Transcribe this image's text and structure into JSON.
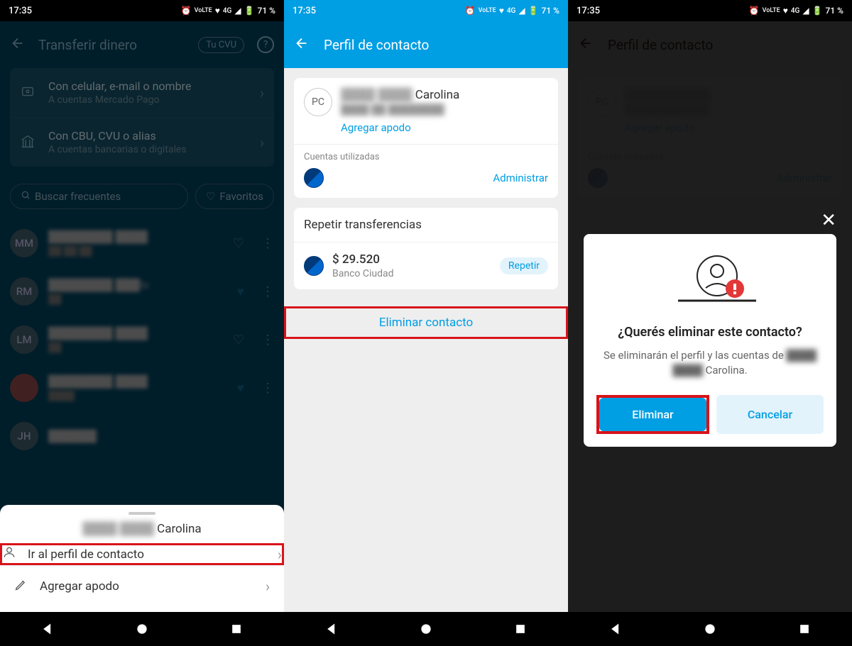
{
  "status": {
    "time": "17:35",
    "battery": "71 %",
    "network": "4G",
    "lte": "VoLTE"
  },
  "screen1": {
    "header": {
      "title": "Transferir dinero",
      "cvu": "Tu CVU"
    },
    "options": [
      {
        "title": "Con celular, e-mail o nombre",
        "subtitle": "A cuentas Mercado Pago"
      },
      {
        "title": "Con CBU, CVU o alias",
        "subtitle": "A cuentas bancarias o digitales"
      }
    ],
    "search": "Buscar frecuentes",
    "favorites": "Favoritos",
    "contacts": [
      {
        "initials": "MM",
        "fav": false
      },
      {
        "initials": "RM",
        "name_suffix": "lo",
        "fav": true
      },
      {
        "initials": "LM",
        "fav": false
      },
      {
        "initials": "",
        "avatar": true,
        "fav": true
      },
      {
        "initials": "JH",
        "fav": false
      }
    ],
    "sheet": {
      "name_visible": "Carolina",
      "go_profile": "Ir al perfil de contacto",
      "add_nickname": "Agregar apodo"
    }
  },
  "screen2": {
    "header": {
      "title": "Perfil de contacto"
    },
    "profile": {
      "initials": "PC",
      "name_visible": "Carolina",
      "add_nickname": "Agregar apodo"
    },
    "accounts": {
      "label": "Cuentas utilizadas",
      "admin": "Administrar"
    },
    "repeat": {
      "title": "Repetir transferencias",
      "amount": "$ 29.520",
      "bank": "Banco Ciudad",
      "button": "Repetir"
    },
    "delete": "Eliminar contacto"
  },
  "screen3": {
    "header": {
      "title": "Perfil de contacto"
    },
    "profile": {
      "initials": "PC",
      "add_nickname": "Agregar apodo"
    },
    "accounts": {
      "label": "Cuentas utilizadas",
      "admin": "Administrar"
    },
    "dialog": {
      "title": "¿Querés eliminar este contacto?",
      "text_prefix": "Se eliminarán el perfil y las cuentas de ",
      "text_name": "Carolina.",
      "confirm": "Eliminar",
      "cancel": "Cancelar"
    }
  }
}
